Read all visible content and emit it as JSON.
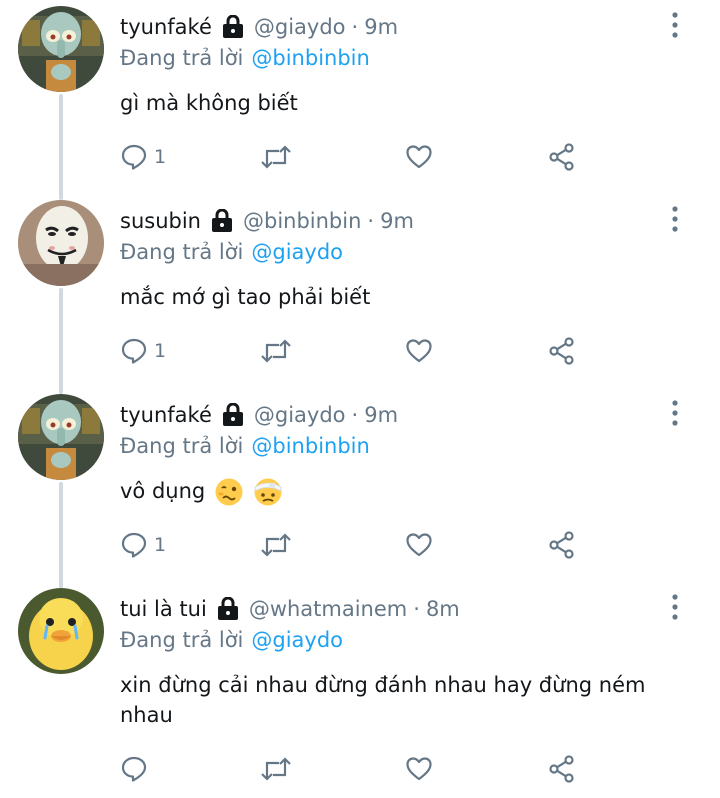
{
  "tweets": [
    {
      "display_name": "tyunfaké",
      "handle": "@giaydo",
      "separator": "·",
      "time": "9m",
      "replying_to_prefix": "Đang trả lời",
      "replying_to": "@binbinbin",
      "text": "gì mà không biết",
      "reply_count": "1",
      "avatar": "squidward-avatar",
      "locked": true
    },
    {
      "display_name": "susubin",
      "handle": "@binbinbin",
      "separator": "·",
      "time": "9m",
      "replying_to_prefix": "Đang trả lời",
      "replying_to": "@giaydo",
      "text": "mắc mớ gì tao phải biết",
      "reply_count": "1",
      "avatar": "guy-fawkes-mask-avatar",
      "locked": true
    },
    {
      "display_name": "tyunfaké",
      "handle": "@giaydo",
      "separator": "·",
      "time": "9m",
      "replying_to_prefix": "Đang trả lời",
      "replying_to": "@binbinbin",
      "text": "vô dụng",
      "emojis": [
        "woozy-face-emoji",
        "head-bandage-emoji"
      ],
      "reply_count": "1",
      "avatar": "squidward-avatar",
      "locked": true
    },
    {
      "display_name": "tui là tui",
      "handle": "@whatmainem",
      "separator": "·",
      "time": "8m",
      "replying_to_prefix": "Đang trả lời",
      "replying_to": "@giaydo",
      "text": "xin đừng cải nhau đừng đánh nhau hay đừng ném nhau",
      "reply_count": "",
      "avatar": "crying-duck-avatar",
      "locked": true
    }
  ],
  "colors": {
    "link": "#1da1f2",
    "secondary_text": "#657786",
    "thread_line": "#cfd9de",
    "icon": "#657786"
  },
  "icons": {
    "reply": "comment-icon",
    "retweet": "retweet-icon",
    "like": "heart-icon",
    "share": "share-icon",
    "more": "more-vertical-icon",
    "lock": "lock-icon"
  }
}
